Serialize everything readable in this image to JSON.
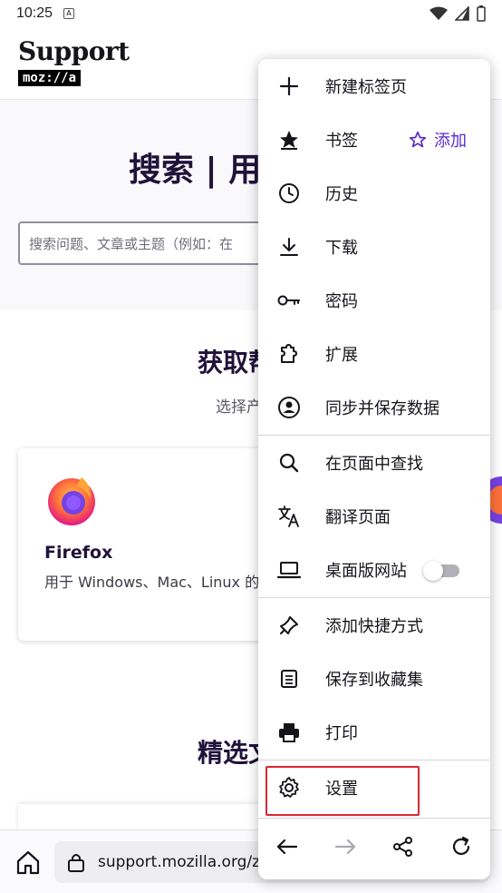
{
  "status_bar": {
    "time": "10:25",
    "notification_icon": "A"
  },
  "site": {
    "logo_text": "Support",
    "logo_sub": "moz://a",
    "hero_title": "搜索 | 用",
    "search_placeholder": "搜索问题、文章或主题（例如：在",
    "section_title": "获取帮",
    "section_sub": "选择产",
    "product": {
      "name": "Firefox",
      "desc": "用于 Windows、Mac、Linux 的"
    },
    "featured_title": "精选文"
  },
  "toolbar": {
    "url": "support.mozilla.org/z"
  },
  "menu": {
    "items": [
      {
        "label": "新建标签页",
        "icon": "plus-icon"
      },
      {
        "label": "书签",
        "icon": "bookmark-star-icon",
        "action": "添加"
      },
      {
        "label": "历史",
        "icon": "clock-icon"
      },
      {
        "label": "下载",
        "icon": "download-icon"
      },
      {
        "label": "密码",
        "icon": "key-icon"
      },
      {
        "label": "扩展",
        "icon": "puzzle-icon"
      },
      {
        "label": "同步并保存数据",
        "icon": "account-icon"
      },
      {
        "label": "在页面中查找",
        "icon": "search-icon"
      },
      {
        "label": "翻译页面",
        "icon": "translate-icon"
      },
      {
        "label": "桌面版网站",
        "icon": "laptop-icon",
        "toggle": false
      },
      {
        "label": "添加快捷方式",
        "icon": "pin-icon"
      },
      {
        "label": "保存到收藏集",
        "icon": "collection-icon"
      },
      {
        "label": "打印",
        "icon": "printer-icon"
      },
      {
        "label": "设置",
        "icon": "gear-icon"
      }
    ],
    "accent_color": "#592acb",
    "highlight_color": "#d9282f"
  }
}
